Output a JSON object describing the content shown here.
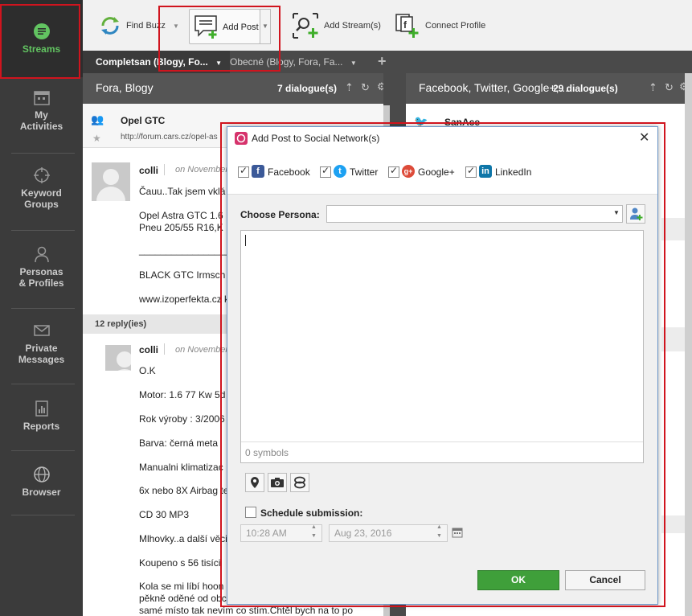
{
  "sidebar": {
    "items": [
      {
        "label": "Streams"
      },
      {
        "label": "My\nActivities"
      },
      {
        "label": "Keyword\nGroups"
      },
      {
        "label": "Personas\n& Profiles"
      },
      {
        "label": "Private\nMessages"
      },
      {
        "label": "Reports"
      },
      {
        "label": "Browser"
      }
    ]
  },
  "toolbar": {
    "find_buzz": "Find Buzz",
    "add_post": "Add Post",
    "add_streams": "Add Stream(s)",
    "connect_profile": "Connect Profile"
  },
  "tabs": [
    {
      "label": "Completsan (Blogy, Fo..."
    },
    {
      "label": "Obecné (Blogy, Fora, Fa..."
    }
  ],
  "columns": {
    "left": {
      "title": "Fora, Blogy",
      "count": "7 dialogue(s)",
      "thread_title": "Opel GTC",
      "thread_url": "http://forum.cars.cz/opel-as",
      "post1": {
        "author": "colli",
        "date": "on November",
        "lines": [
          "Čauu..Tak jsem vklá",
          "Opel Astra GTC 1.6",
          "Pneu 205/55 R16,K",
          "____________________",
          "BLACK GTC Irmsch",
          "www.izoperfekta.cz k"
        ]
      },
      "replies": "12 reply(ies)",
      "post2": {
        "author": "colli",
        "date": "on November",
        "lines": [
          "O.K",
          "Motor: 1.6 77 Kw 5d",
          "Rok výroby : 3/2006",
          "Barva: černá meta",
          "Manualni klimatizac",
          "6x nebo 8X Airbag te",
          "CD 30 MP3",
          "Mlhovky..a další věci",
          "Koupeno s 56 tisíci",
          "Kola se mi líbí hoon",
          "pěkně oděné od obchodníka a to nekoukla na to",
          "samé místo tak nevím co stím.Chtěl bych na to po"
        ]
      }
    },
    "right": {
      "title": "Facebook, Twitter, Google+,...",
      "count": "29 dialogue(s)",
      "first_author": "SanAce"
    }
  },
  "dialog": {
    "title": "Add Post to Social Network(s)",
    "networks": [
      {
        "label": "Facebook",
        "checked": true,
        "icon": "facebook-icon",
        "color": "#3b5998"
      },
      {
        "label": "Twitter",
        "checked": true,
        "icon": "twitter-icon",
        "color": "#1da1f2"
      },
      {
        "label": "Google+",
        "checked": true,
        "icon": "google-plus-icon",
        "color": "#dd4b39"
      },
      {
        "label": "LinkedIn",
        "checked": true,
        "icon": "linkedin-icon",
        "color": "#0e76a8"
      }
    ],
    "persona_label": "Choose Persona:",
    "persona_value": "",
    "message_value": "",
    "symbols": "0 symbols",
    "schedule_label": "Schedule submission:",
    "time_value": "10:28 AM",
    "date_value": "Aug 23, 2016",
    "ok": "OK",
    "cancel": "Cancel"
  },
  "colors": {
    "accent_green": "#62c461",
    "ok_green": "#3f9f3a",
    "annotation_red": "#d0141e"
  }
}
